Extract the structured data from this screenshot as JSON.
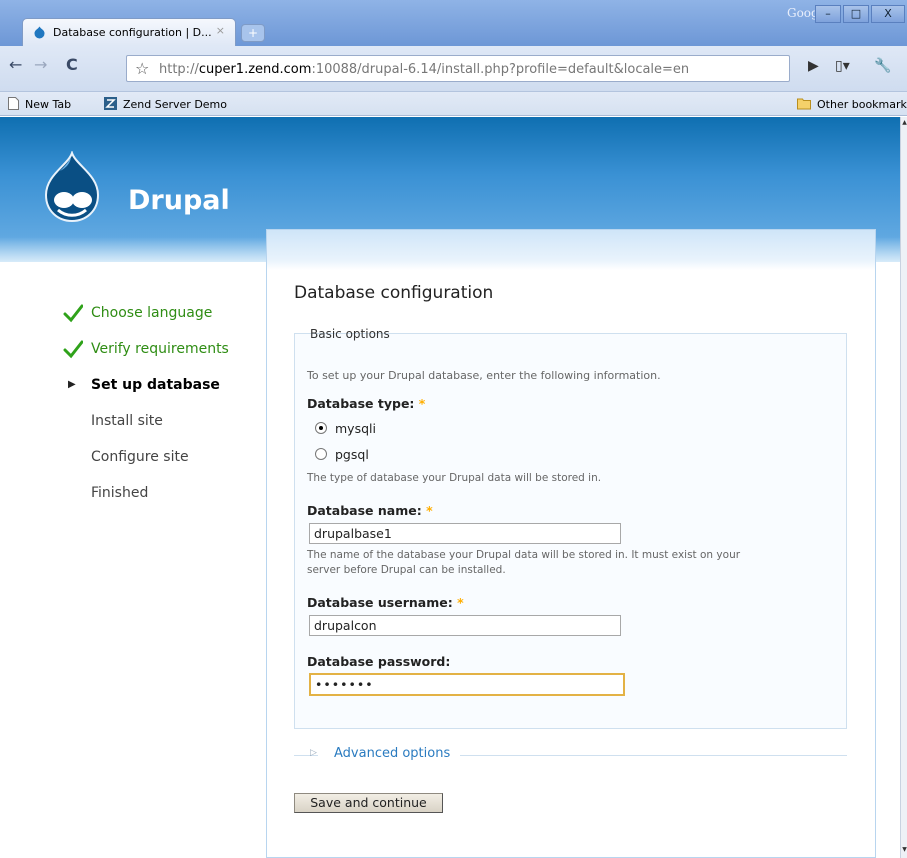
{
  "browser": {
    "tab_title": "Database configuration | D...",
    "tab_close": "×",
    "new_tab_symbol": "+",
    "brand_text": "Google",
    "url_scheme": "http://",
    "url_host": "cuper1.zend.com",
    "url_rest": ":10088/drupal-6.14/install.php?profile=default&locale=en",
    "bookmarks": [
      {
        "label": "New Tab"
      },
      {
        "label": "Zend Server Demo"
      }
    ],
    "other_bookmarks": "Other bookmarks"
  },
  "site": {
    "name": "Drupal"
  },
  "steps": [
    {
      "label": "Choose language",
      "status": "done"
    },
    {
      "label": "Verify requirements",
      "status": "done"
    },
    {
      "label": "Set up database",
      "status": "active"
    },
    {
      "label": "Install site",
      "status": "pending"
    },
    {
      "label": "Configure site",
      "status": "pending"
    },
    {
      "label": "Finished",
      "status": "pending"
    }
  ],
  "form": {
    "title": "Database configuration",
    "fieldset_legend": "Basic options",
    "intro": "To set up your Drupal database, enter the following information.",
    "required_marker": "*",
    "db_type": {
      "label": "Database type:",
      "options": [
        "mysqli",
        "pgsql"
      ],
      "selected": "mysqli",
      "description": "The type of database your Drupal data will be stored in."
    },
    "db_name": {
      "label": "Database name:",
      "value": "drupalbase1",
      "description_line1": "The name of the database your Drupal data will be stored in. It must exist on your",
      "description_line2": "server before Drupal can be installed."
    },
    "db_username": {
      "label": "Database username:",
      "value": "drupalcon"
    },
    "db_password": {
      "label": "Database password:",
      "masked_value": "•••••••"
    },
    "advanced_options": "Advanced options",
    "submit_label": "Save and continue"
  },
  "colors": {
    "header_blue": "#1a78bd",
    "done_green": "#2f8d14",
    "link_blue": "#2a7bc0",
    "required_orange": "#ffae00",
    "focus_border": "#e3b245"
  }
}
